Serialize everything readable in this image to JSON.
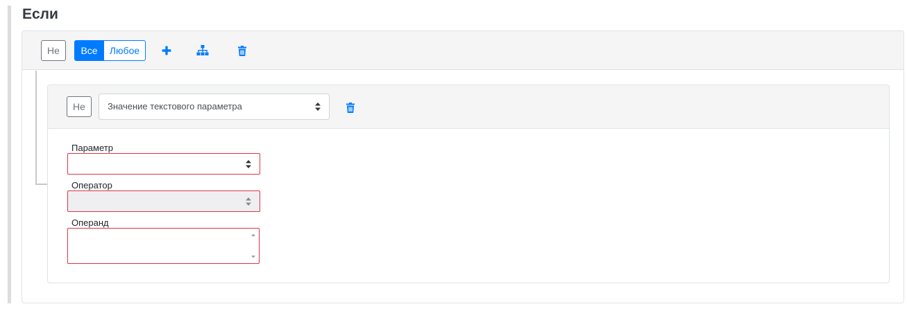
{
  "section_title": "Если",
  "group": {
    "not_label": "Не",
    "all_label": "Все",
    "any_label": "Любое",
    "add_icon": "plus-icon",
    "add_group_icon": "sitemap-icon",
    "delete_icon": "trash-icon",
    "accent_color": "#007bff"
  },
  "rule": {
    "not_label": "Не",
    "condition_type": "Значение текстового параметра",
    "delete_icon": "trash-icon",
    "fields": {
      "parameter_label": "Параметр",
      "parameter_value": "",
      "operator_label": "Оператор",
      "operator_value": "",
      "operand_label": "Операнд",
      "operand_value": ""
    },
    "invalid_border_color": "#dc3545"
  }
}
